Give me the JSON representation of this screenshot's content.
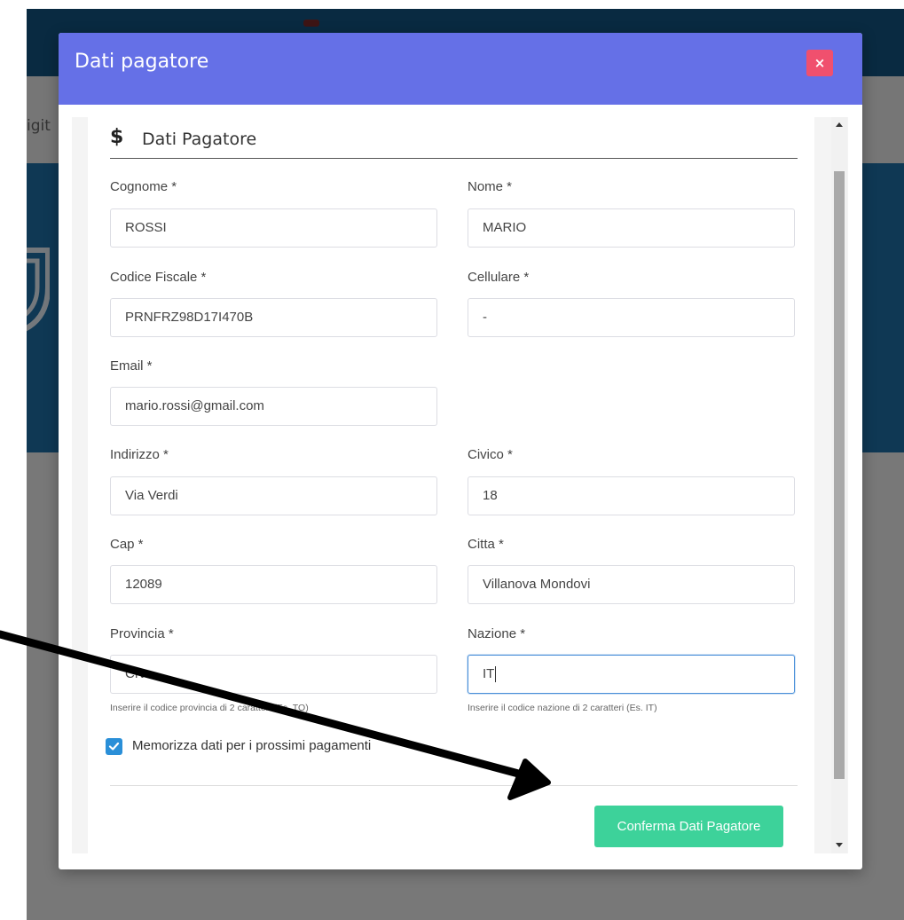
{
  "background_app": {
    "nav_fragment": "igit"
  },
  "modal": {
    "title": "Dati pagatore",
    "close_glyph": "×",
    "section_title": "Dati Pagatore",
    "section_icon": "$",
    "fields": {
      "cognome": {
        "label": "Cognome *",
        "value": "ROSSI"
      },
      "nome": {
        "label": "Nome *",
        "value": "MARIO"
      },
      "codice_fiscale": {
        "label": "Codice Fiscale *",
        "value": "PRNFRZ98D17I470B"
      },
      "cellulare": {
        "label": "Cellulare *",
        "value": "-"
      },
      "email": {
        "label": "Email *",
        "value": "mario.rossi@gmail.com"
      },
      "indirizzo": {
        "label": "Indirizzo *",
        "value": "Via Verdi"
      },
      "civico": {
        "label": "Civico *",
        "value": "18"
      },
      "cap": {
        "label": "Cap *",
        "value": "12089"
      },
      "citta": {
        "label": "Citta *",
        "value": "Villanova Mondovi"
      },
      "provincia": {
        "label": "Provincia *",
        "value": "CN",
        "help": "Inserire il codice provincia di 2 caratteri (Es. TO)"
      },
      "nazione": {
        "label": "Nazione *",
        "value": "IT",
        "help": "Inserire il codice nazione di 2 caratteri (Es. IT)"
      }
    },
    "remember": {
      "label": "Memorizza dati per i prossimi pagamenti",
      "checked": true
    },
    "confirm_label": "Conferma Dati Pagatore"
  },
  "colors": {
    "header_blue": "#135583",
    "banner_blue": "#1e71a8",
    "modal_header": "#6570e7",
    "close_button": "#f0506e",
    "confirm_button": "#3dd29a",
    "checkbox": "#2a8fd8",
    "focus_border": "#4a90d9"
  }
}
